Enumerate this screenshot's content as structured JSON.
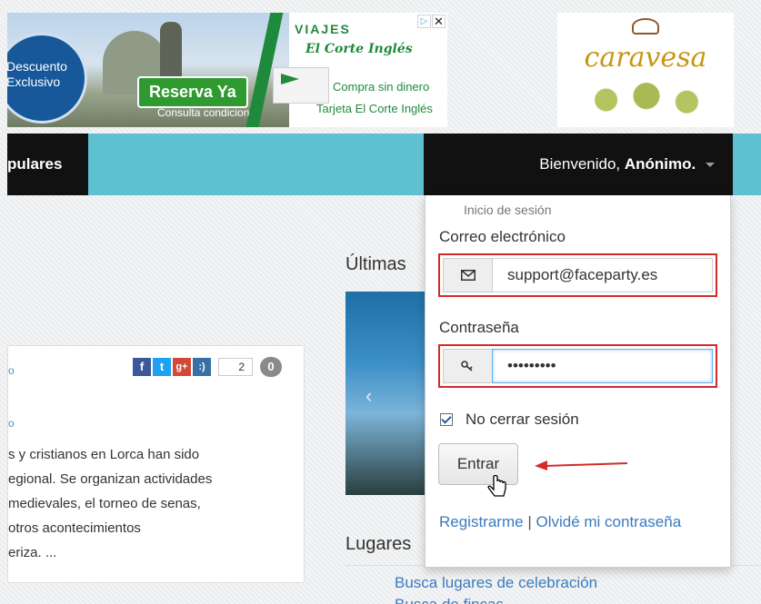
{
  "ad": {
    "discount_line1": "Descuento",
    "discount_line2": "Exclusivo",
    "reserve_label": "Reserva Ya",
    "consult_label": "Consulta condiciones",
    "brand_top": "VIAJES",
    "brand_name": "El Corte Inglés",
    "tagline1": "Compra sin dinero",
    "tagline2": "Tarjeta El Corte Inglés",
    "adchoices": "▷",
    "close": "✕"
  },
  "logo": {
    "text": "caravesa"
  },
  "nav": {
    "item_label": "pulares",
    "welcome_prefix": "Bienvenido,",
    "username": "Anónimo."
  },
  "article": {
    "share_count": "2",
    "comment_count": "0",
    "excerpt_lines": [
      "s y cristianos en Lorca han sido",
      "egional. Se organizan actividades",
      " medievales, el torneo de senas,",
      " otros acontecimientos",
      "eriza. ..."
    ]
  },
  "sidebar": {
    "latest_heading": "Últimas",
    "places_heading": "Lugares",
    "places_link": "Busca lugares de celebración",
    "places_link2": "Busca de fincas"
  },
  "login": {
    "heading": "Inicio de sesión",
    "email_label": "Correo electrónico",
    "email_value": "support@faceparty.es",
    "password_label": "Contraseña",
    "password_value": "•••••••••",
    "remember_label": "No cerrar sesión",
    "remember_checked": true,
    "submit_label": "Entrar",
    "register_link": "Registrarme",
    "separator": "|",
    "forgot_link": "Olvidé mi contraseña"
  },
  "colors": {
    "nav_teal": "#5fc0cf",
    "nav_dark": "#111111",
    "highlight_red": "#d42a2a",
    "link_blue": "#3a7bbf"
  }
}
